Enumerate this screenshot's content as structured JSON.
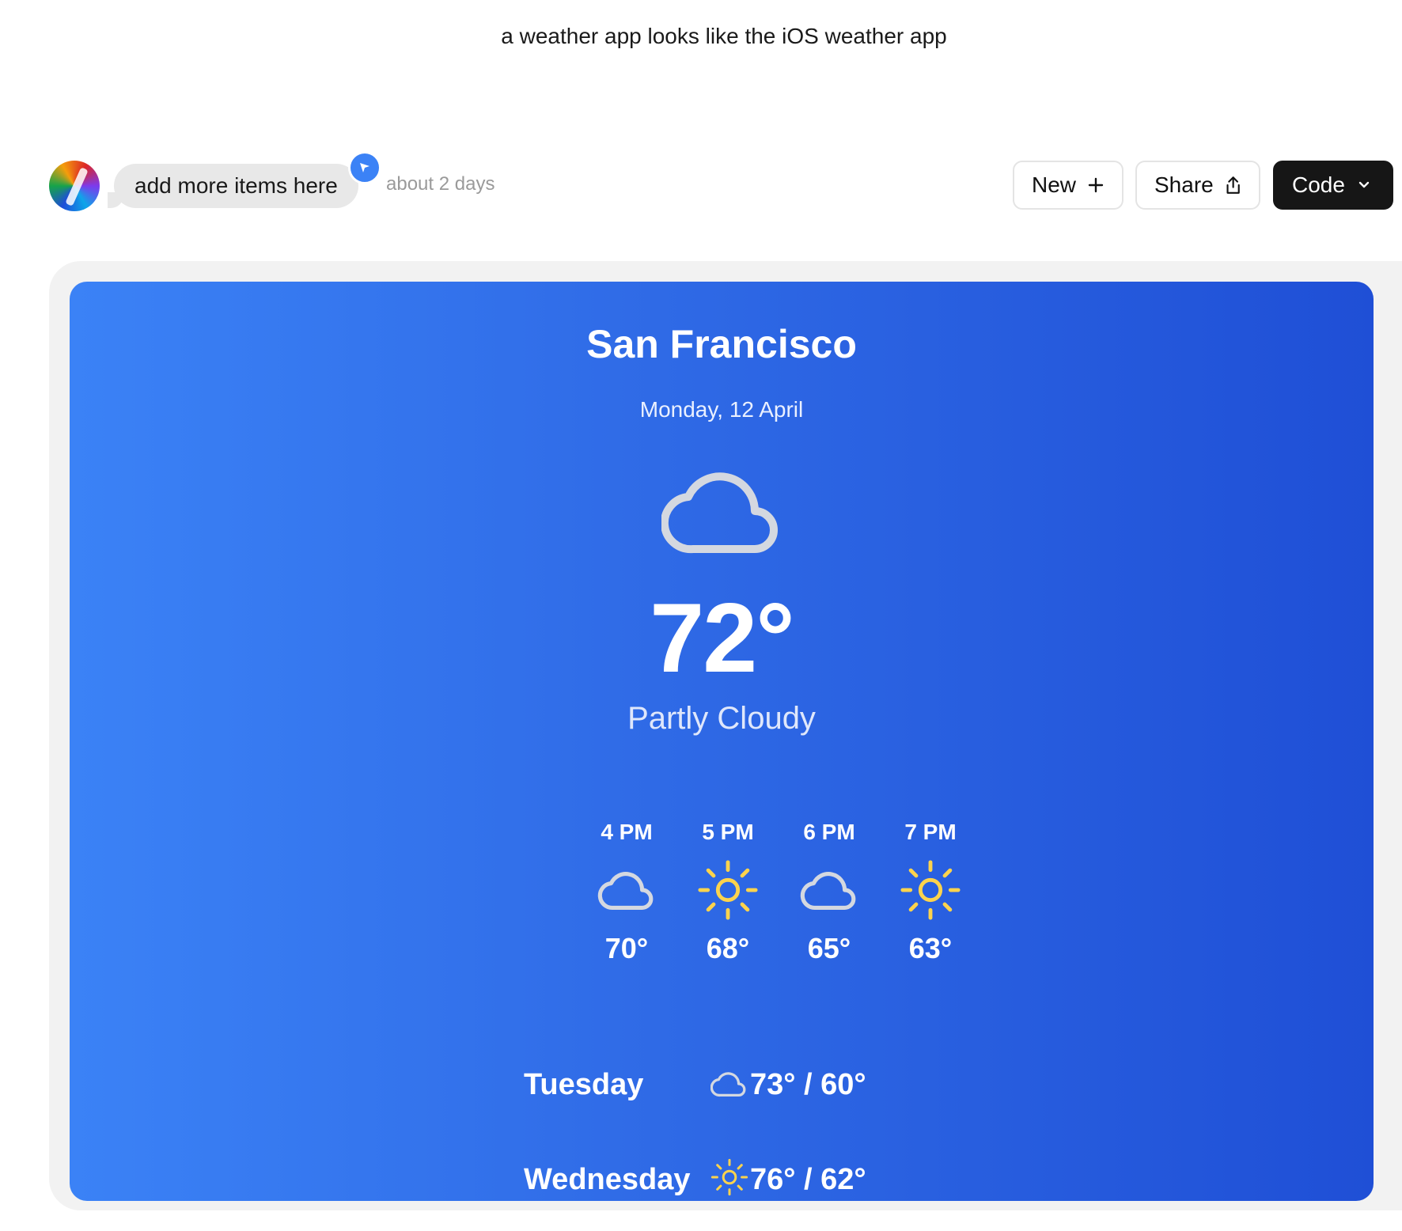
{
  "prompt": "a weather app looks like the iOS weather app",
  "chat": {
    "message": "add more items here",
    "time": "about 2 days"
  },
  "toolbar": {
    "new_label": "New",
    "share_label": "Share",
    "code_label": "Code"
  },
  "weather": {
    "city": "San Francisco",
    "date": "Monday, 12 April",
    "current_icon": "cloud-icon",
    "temperature": "72°",
    "condition": "Partly Cloudy",
    "hourly": [
      {
        "time": "4 PM",
        "icon": "cloud-icon",
        "temp": "70°"
      },
      {
        "time": "5 PM",
        "icon": "sun-icon",
        "temp": "68°"
      },
      {
        "time": "6 PM",
        "icon": "cloud-icon",
        "temp": "65°"
      },
      {
        "time": "7 PM",
        "icon": "sun-icon",
        "temp": "63°"
      }
    ],
    "daily": [
      {
        "day": "Tuesday",
        "icon": "cloud-icon",
        "range": "73° / 60°"
      },
      {
        "day": "Wednesday",
        "icon": "sun-icon",
        "range": "76° / 62°"
      }
    ]
  },
  "colors": {
    "gradient_start": "#3b82f6",
    "gradient_end": "#1f4fd6",
    "sun": "#fcd34d",
    "cloud": "#d4d8e0",
    "code_button": "#161616"
  }
}
